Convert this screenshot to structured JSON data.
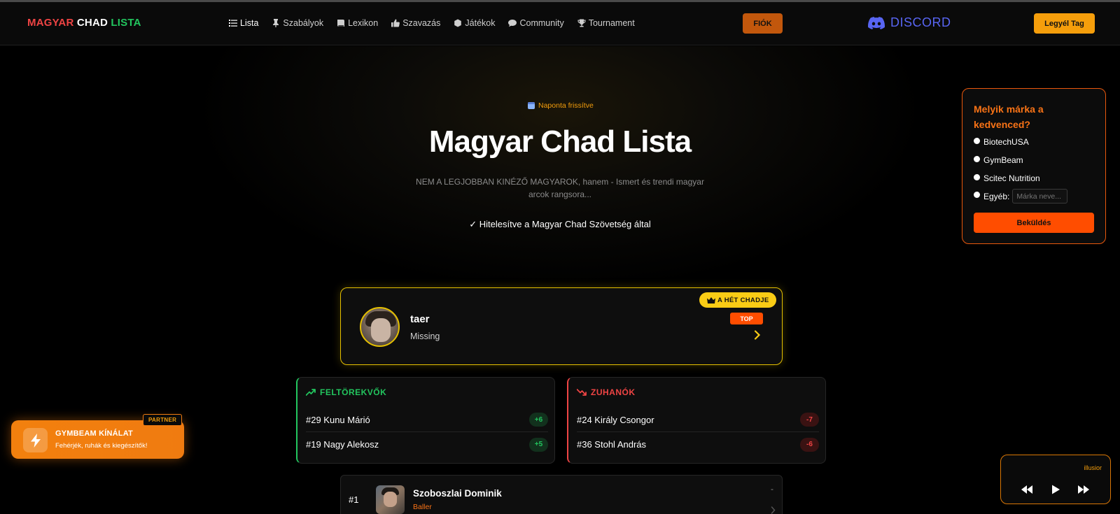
{
  "brand": {
    "part1": "MAGYAR",
    "part2": "CHAD",
    "part3": "LISTA"
  },
  "nav": {
    "items": [
      {
        "label": "Lista",
        "icon": "list-icon",
        "active": true
      },
      {
        "label": "Szabályok",
        "icon": "pin-icon"
      },
      {
        "label": "Lexikon",
        "icon": "book-icon"
      },
      {
        "label": "Szavazás",
        "icon": "thumbs-up-icon"
      },
      {
        "label": "Játékok",
        "icon": "dice-icon"
      },
      {
        "label": "Community",
        "icon": "chat-icon"
      },
      {
        "label": "Tournament",
        "icon": "trophy-icon"
      }
    ],
    "account_label": "FIÓK",
    "discord_label": "DISCORD",
    "join_label": "Legyél Tag"
  },
  "hero": {
    "badge": "Naponta frissítve",
    "title": "Magyar Chad Lista",
    "subtitle": "NEM A LEGJOBBAN KINÉZŐ MAGYAROK, hanem - Ismert és trendi magyar arcok rangsora...",
    "verified": "✓ Hitelesítve a Magyar Chad Szövetség által"
  },
  "poll": {
    "question": "Melyik márka a kedvenced?",
    "options": [
      "BiotechUSA",
      "GymBeam",
      "Scitec Nutrition"
    ],
    "other_label": "Egyéb:",
    "other_placeholder": "Márka neve...",
    "submit": "Beküldés"
  },
  "week_chad": {
    "badge": "A HÉT CHADJE",
    "name": "taer",
    "subtitle": "Missing",
    "tag": "TOP"
  },
  "risers": {
    "title": "FELTÖREKVŐK",
    "rows": [
      {
        "name": "#29 Kunu Márió",
        "delta": "+6"
      },
      {
        "name": "#19 Nagy Alekosz",
        "delta": "+5"
      }
    ]
  },
  "fallers": {
    "title": "ZUHANÓK",
    "rows": [
      {
        "name": "#24 Király Csongor",
        "delta": "-7"
      },
      {
        "name": "#36 Stohl András",
        "delta": "-6"
      }
    ]
  },
  "list": [
    {
      "rank": "#1",
      "name": "Szoboszlai Dominik",
      "tag": "Baller",
      "change": "-"
    }
  ],
  "partner": {
    "pill": "PARTNER",
    "title": "GYMBEAM KÍNÁLAT",
    "subtitle": "Fehérjék, ruhák és kiegészítők!"
  },
  "player": {
    "track": "illusior"
  },
  "colors": {
    "accent_orange": "#ff4d00",
    "gold": "#facc15",
    "green": "#22c55e",
    "red": "#ef4444",
    "discord": "#5865f2"
  }
}
